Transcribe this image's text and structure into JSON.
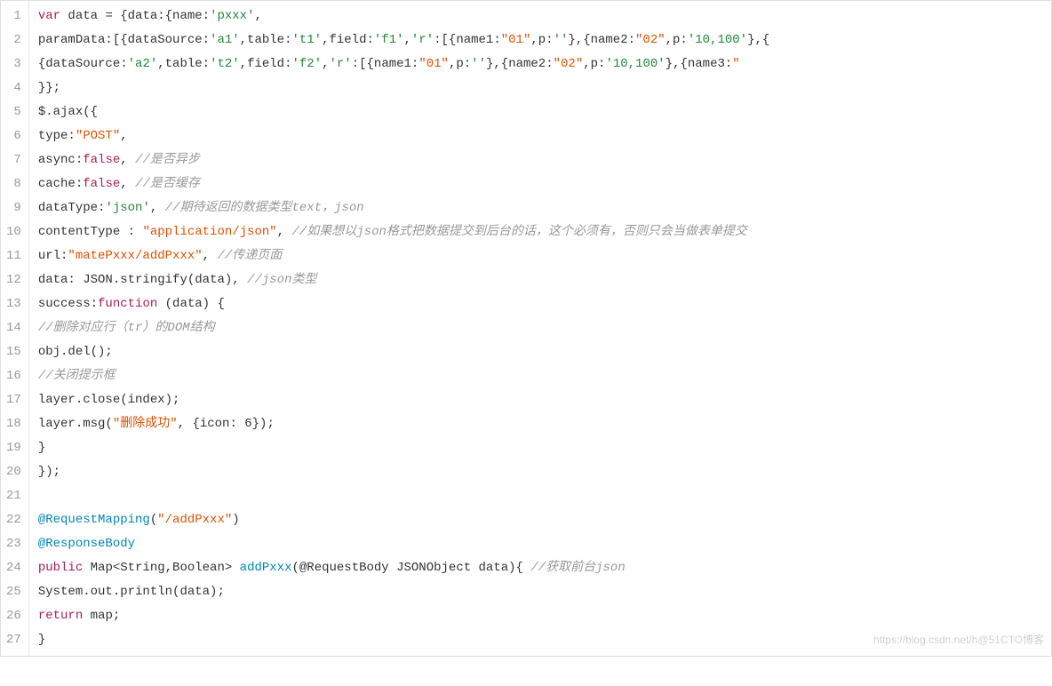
{
  "watermark": "https://blog.csdn.net/h@51CTO博客",
  "lines": [
    {
      "num": "1",
      "tokens": [
        {
          "cls": "k",
          "t": "var"
        },
        {
          "cls": "n",
          "t": " data = {data:{name:"
        },
        {
          "cls": "s",
          "t": "'pxxx'"
        },
        {
          "cls": "n",
          "t": ","
        }
      ]
    },
    {
      "num": "2",
      "tokens": [
        {
          "cls": "n",
          "t": "                   paramData:[{dataSource:"
        },
        {
          "cls": "s",
          "t": "'a1'"
        },
        {
          "cls": "n",
          "t": ",table:"
        },
        {
          "cls": "s",
          "t": "'t1'"
        },
        {
          "cls": "n",
          "t": ",field:"
        },
        {
          "cls": "s",
          "t": "'f1'"
        },
        {
          "cls": "n",
          "t": ","
        },
        {
          "cls": "s",
          "t": "'r'"
        },
        {
          "cls": "n",
          "t": ":[{name1:"
        },
        {
          "cls": "str2",
          "t": "\"01\""
        },
        {
          "cls": "n",
          "t": ",p:"
        },
        {
          "cls": "s",
          "t": "''"
        },
        {
          "cls": "n",
          "t": "},{name2:"
        },
        {
          "cls": "str2",
          "t": "\"02\""
        },
        {
          "cls": "n",
          "t": ",p:"
        },
        {
          "cls": "s",
          "t": "'10,100'"
        },
        {
          "cls": "n",
          "t": "},{"
        }
      ]
    },
    {
      "num": "3",
      "tokens": [
        {
          "cls": "n",
          "t": "                        {dataSource:"
        },
        {
          "cls": "s",
          "t": "'a2'"
        },
        {
          "cls": "n",
          "t": ",table:"
        },
        {
          "cls": "s",
          "t": "'t2'"
        },
        {
          "cls": "n",
          "t": ",field:"
        },
        {
          "cls": "s",
          "t": "'f2'"
        },
        {
          "cls": "n",
          "t": ","
        },
        {
          "cls": "s",
          "t": "'r'"
        },
        {
          "cls": "n",
          "t": ":[{name1:"
        },
        {
          "cls": "str2",
          "t": "\"01\""
        },
        {
          "cls": "n",
          "t": ",p:"
        },
        {
          "cls": "s",
          "t": "''"
        },
        {
          "cls": "n",
          "t": "},{name2:"
        },
        {
          "cls": "str2",
          "t": "\"02\""
        },
        {
          "cls": "n",
          "t": ",p:"
        },
        {
          "cls": "s",
          "t": "'10,100'"
        },
        {
          "cls": "n",
          "t": "},{name3:"
        },
        {
          "cls": "str2",
          "t": "\""
        }
      ]
    },
    {
      "num": "4",
      "tokens": [
        {
          "cls": "n",
          "t": "                 }};"
        }
      ]
    },
    {
      "num": "5",
      "tokens": [
        {
          "cls": "n",
          "t": "$.ajax({"
        }
      ]
    },
    {
      "num": "6",
      "tokens": [
        {
          "cls": "n",
          "t": "    type:"
        },
        {
          "cls": "str2",
          "t": "\"POST\""
        },
        {
          "cls": "n",
          "t": ","
        }
      ]
    },
    {
      "num": "7",
      "tokens": [
        {
          "cls": "n",
          "t": "    async:"
        },
        {
          "cls": "k",
          "t": "false"
        },
        {
          "cls": "n",
          "t": ",    "
        },
        {
          "cls": "c",
          "t": "//是否异步"
        }
      ]
    },
    {
      "num": "8",
      "tokens": [
        {
          "cls": "n",
          "t": "    cache:"
        },
        {
          "cls": "k",
          "t": "false"
        },
        {
          "cls": "n",
          "t": ",    "
        },
        {
          "cls": "c",
          "t": "//是否缓存"
        }
      ]
    },
    {
      "num": "9",
      "tokens": [
        {
          "cls": "n",
          "t": "    dataType:"
        },
        {
          "cls": "s",
          "t": "'json'"
        },
        {
          "cls": "n",
          "t": ",    "
        },
        {
          "cls": "c",
          "t": "//期待返回的数据类型text，json"
        }
      ]
    },
    {
      "num": "10",
      "tokens": [
        {
          "cls": "n",
          "t": "    contentType : "
        },
        {
          "cls": "str2",
          "t": "\"application/json\""
        },
        {
          "cls": "n",
          "t": ",    "
        },
        {
          "cls": "c",
          "t": "//如果想以json格式把数据提交到后台的话，这个必须有，否则只会当做表单提交"
        }
      ]
    },
    {
      "num": "11",
      "tokens": [
        {
          "cls": "n",
          "t": "    url:"
        },
        {
          "cls": "str2",
          "t": "\"matePxxx/addPxxx\""
        },
        {
          "cls": "n",
          "t": ",    "
        },
        {
          "cls": "c",
          "t": "//传递页面"
        }
      ]
    },
    {
      "num": "12",
      "tokens": [
        {
          "cls": "n",
          "t": "    data: JSON.stringify(data),    "
        },
        {
          "cls": "c",
          "t": "//json类型"
        }
      ]
    },
    {
      "num": "13",
      "tokens": [
        {
          "cls": "n",
          "t": "    success:"
        },
        {
          "cls": "k",
          "t": "function"
        },
        {
          "cls": "n",
          "t": " (data) {"
        }
      ]
    },
    {
      "num": "14",
      "tokens": [
        {
          "cls": "n",
          "t": "                     "
        },
        {
          "cls": "c",
          "t": "//删除对应行（tr）的DOM结构"
        }
      ]
    },
    {
      "num": "15",
      "tokens": [
        {
          "cls": "n",
          "t": "                        obj.del();"
        }
      ]
    },
    {
      "num": "16",
      "tokens": [
        {
          "cls": "n",
          "t": "                        "
        },
        {
          "cls": "c",
          "t": "//关闭提示框"
        }
      ]
    },
    {
      "num": "17",
      "tokens": [
        {
          "cls": "n",
          "t": "                        layer.close(index);"
        }
      ]
    },
    {
      "num": "18",
      "tokens": [
        {
          "cls": "n",
          "t": "                     layer.msg("
        },
        {
          "cls": "str2",
          "t": "\"删除成功\""
        },
        {
          "cls": "n",
          "t": ", {icon: 6});"
        }
      ]
    },
    {
      "num": "19",
      "tokens": [
        {
          "cls": "n",
          "t": "               }"
        }
      ]
    },
    {
      "num": "20",
      "tokens": [
        {
          "cls": "n",
          "t": "});"
        }
      ]
    },
    {
      "num": "21",
      "tokens": [
        {
          "cls": "n",
          "t": " "
        }
      ]
    },
    {
      "num": "22",
      "tokens": [
        {
          "cls": "a",
          "t": "@RequestMapping"
        },
        {
          "cls": "n",
          "t": "("
        },
        {
          "cls": "str2",
          "t": "\"/addPxxx\""
        },
        {
          "cls": "n",
          "t": ")"
        }
      ]
    },
    {
      "num": "23",
      "tokens": [
        {
          "cls": "a",
          "t": "@ResponseBody"
        }
      ]
    },
    {
      "num": "24",
      "tokens": [
        {
          "cls": "k",
          "t": "public"
        },
        {
          "cls": "n",
          "t": " Map<String,Boolean> "
        },
        {
          "cls": "a",
          "t": "addPxxx"
        },
        {
          "cls": "n",
          "t": "(@RequestBody JSONObject data){    "
        },
        {
          "cls": "c",
          "t": "//获取前台json"
        }
      ]
    },
    {
      "num": "25",
      "tokens": [
        {
          "cls": "n",
          "t": "   System.out.println(data);"
        }
      ]
    },
    {
      "num": "26",
      "tokens": [
        {
          "cls": "n",
          "t": "  "
        },
        {
          "cls": "k",
          "t": "return"
        },
        {
          "cls": "n",
          "t": " map;"
        }
      ]
    },
    {
      "num": "27",
      "tokens": [
        {
          "cls": "n",
          "t": "}"
        }
      ]
    }
  ]
}
